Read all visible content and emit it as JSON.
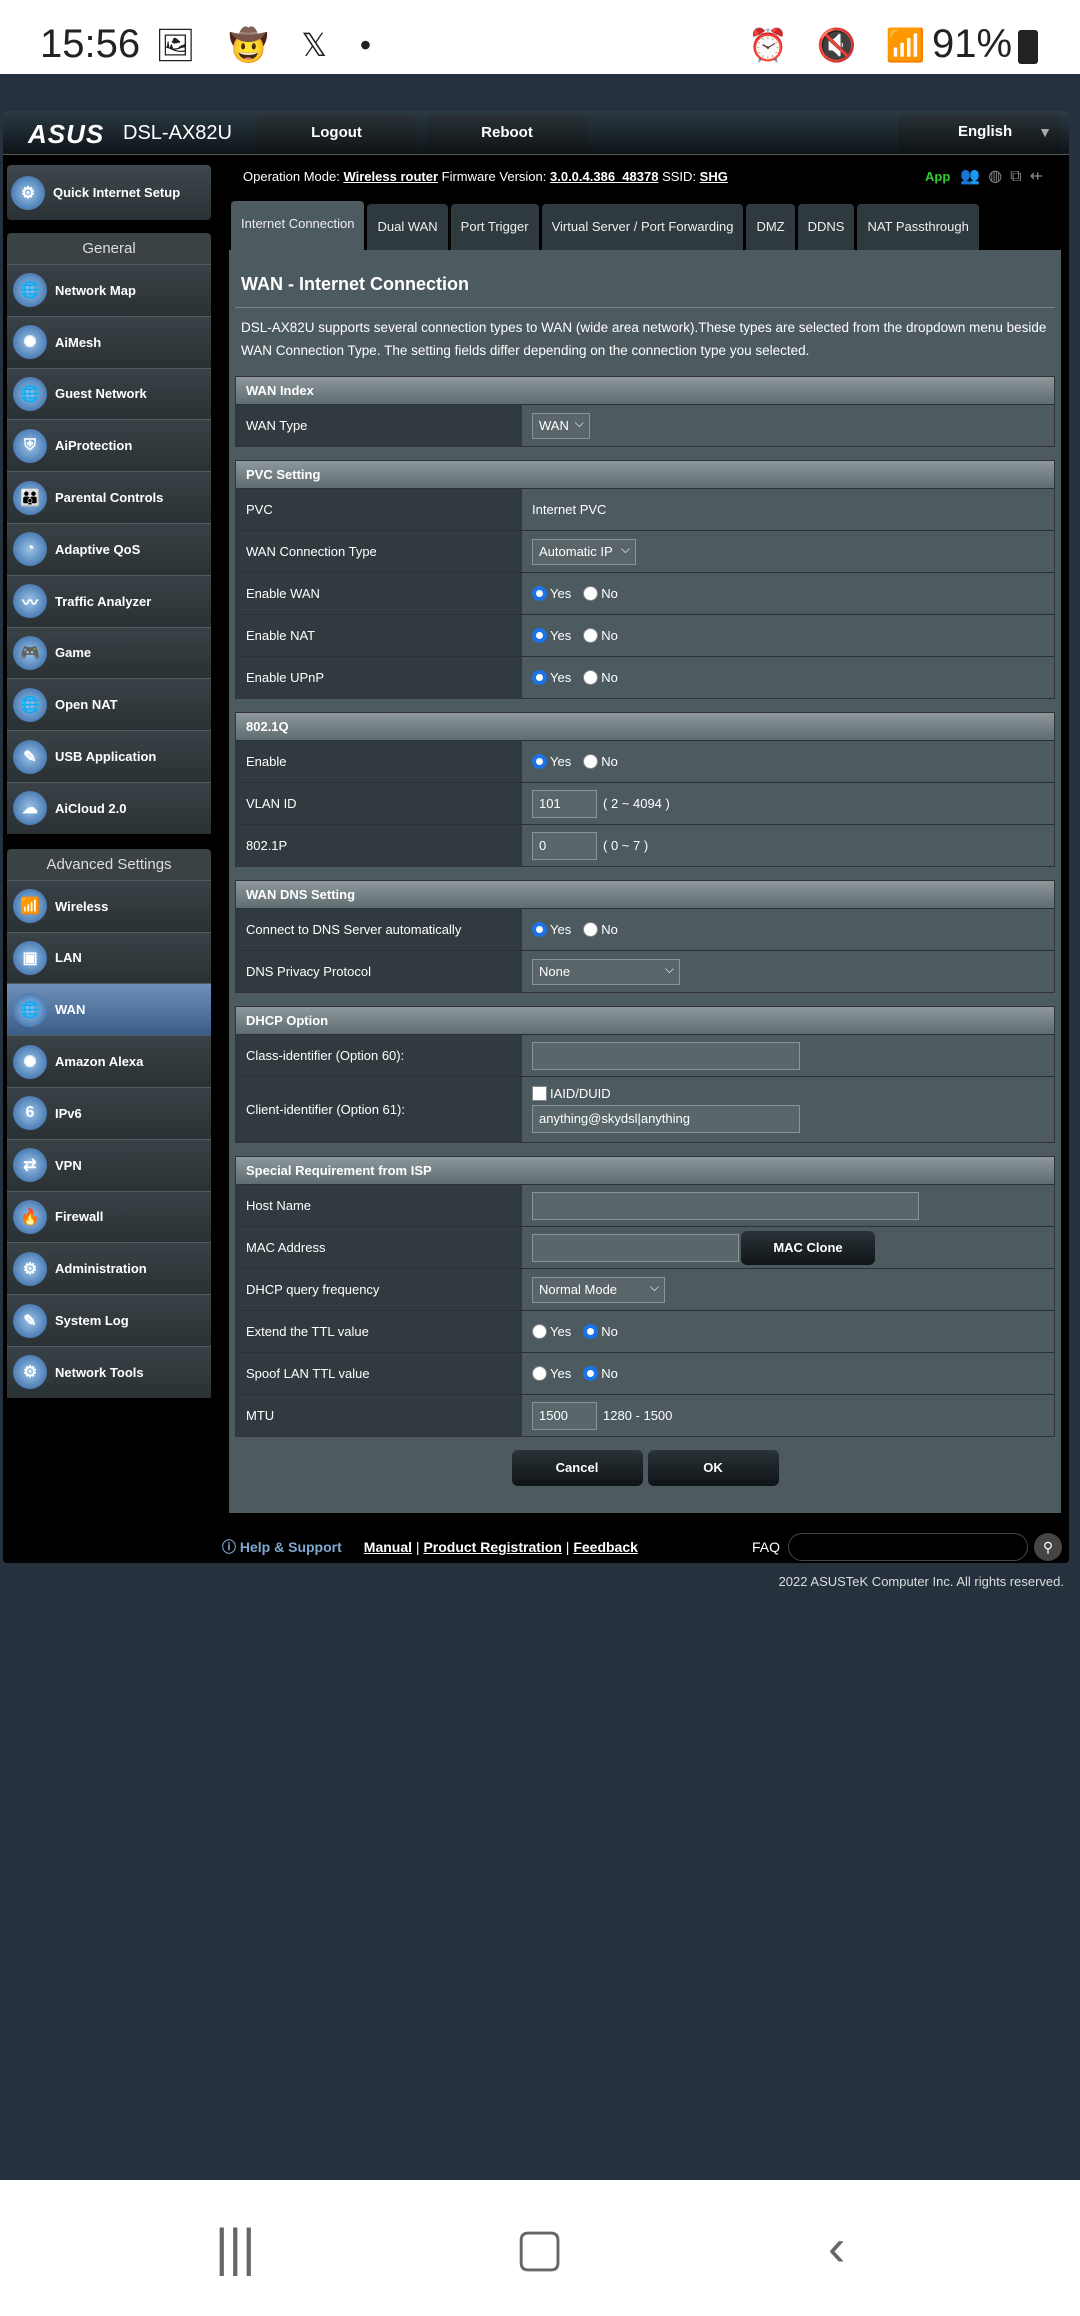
{
  "statusbar": {
    "time": "15:56",
    "battery": "91%"
  },
  "header": {
    "brand": "ASUS",
    "model": "DSL-AX82U",
    "logout": "Logout",
    "reboot": "Reboot",
    "language": "English"
  },
  "info": {
    "op_mode_label": "Operation Mode:",
    "op_mode": "Wireless router",
    "fw_label": "Firmware Version:",
    "fw": "3.0.0.4.386_48378",
    "ssid_label": "SSID:",
    "ssid": "SHG",
    "app": "App"
  },
  "sidebar": {
    "qis": "Quick Internet Setup",
    "general_title": "General",
    "general": [
      {
        "label": "Network Map",
        "icon": "network-map-icon",
        "g": "🌐"
      },
      {
        "label": "AiMesh",
        "icon": "aimesh-icon",
        "g": "✺"
      },
      {
        "label": "Guest Network",
        "icon": "guest-network-icon",
        "g": "🌐"
      },
      {
        "label": "AiProtection",
        "icon": "shield-icon",
        "g": "⛨"
      },
      {
        "label": "Parental Controls",
        "icon": "parental-controls-icon",
        "g": "👪"
      },
      {
        "label": "Adaptive QoS",
        "icon": "gauge-icon",
        "g": "◔"
      },
      {
        "label": "Traffic Analyzer",
        "icon": "traffic-analyzer-icon",
        "g": "〰"
      },
      {
        "label": "Game",
        "icon": "gamepad-icon",
        "g": "🎮"
      },
      {
        "label": "Open NAT",
        "icon": "open-nat-icon",
        "g": "🌐"
      },
      {
        "label": "USB Application",
        "icon": "usb-icon",
        "g": "✎"
      },
      {
        "label": "AiCloud 2.0",
        "icon": "cloud-icon",
        "g": "☁"
      }
    ],
    "advanced_title": "Advanced Settings",
    "advanced": [
      {
        "label": "Wireless",
        "icon": "wireless-icon",
        "g": "📶"
      },
      {
        "label": "LAN",
        "icon": "lan-icon",
        "g": "▣"
      },
      {
        "label": "WAN",
        "icon": "wan-globe-icon",
        "g": "🌐",
        "active": true
      },
      {
        "label": "Amazon Alexa",
        "icon": "alexa-icon",
        "g": "✺"
      },
      {
        "label": "IPv6",
        "icon": "ipv6-icon",
        "g": "6"
      },
      {
        "label": "VPN",
        "icon": "vpn-icon",
        "g": "⇄"
      },
      {
        "label": "Firewall",
        "icon": "firewall-icon",
        "g": "🔥"
      },
      {
        "label": "Administration",
        "icon": "gear-icon",
        "g": "⚙"
      },
      {
        "label": "System Log",
        "icon": "system-log-icon",
        "g": "✎"
      },
      {
        "label": "Network Tools",
        "icon": "network-tools-icon",
        "g": "⚙"
      }
    ]
  },
  "tabs": [
    {
      "label": "Internet Connection",
      "active": true
    },
    {
      "label": "Dual WAN"
    },
    {
      "label": "Port Trigger"
    },
    {
      "label": "Virtual Server / Port Forwarding"
    },
    {
      "label": "DMZ"
    },
    {
      "label": "DDNS"
    },
    {
      "label": "NAT Passthrough"
    }
  ],
  "page": {
    "title": "WAN - Internet Connection",
    "description": "DSL-AX82U supports several connection types to WAN (wide area network).These types are selected from the dropdown menu beside WAN Connection Type. The setting fields differ depending on the connection type you selected."
  },
  "radio": {
    "yes": "Yes",
    "no": "No"
  },
  "sections": [
    {
      "title": "WAN Index",
      "rows": [
        {
          "key": "wan_type",
          "label": "WAN Type",
          "type": "select",
          "value": "WAN"
        }
      ]
    },
    {
      "title": "PVC Setting",
      "rows": [
        {
          "key": "pvc",
          "label": "PVC",
          "type": "text",
          "value": "Internet PVC"
        },
        {
          "key": "conn_type",
          "label": "WAN Connection Type",
          "type": "select",
          "value": "Automatic IP"
        },
        {
          "key": "enable_wan",
          "label": "Enable WAN",
          "type": "radio",
          "value": "yes"
        },
        {
          "key": "enable_nat",
          "label": "Enable NAT",
          "type": "radio",
          "value": "yes"
        },
        {
          "key": "enable_upnp",
          "label": "Enable UPnP",
          "type": "radio",
          "value": "yes"
        }
      ]
    },
    {
      "title": "802.1Q",
      "rows": [
        {
          "key": "vlan_enable",
          "label": "Enable",
          "type": "radio",
          "value": "yes"
        },
        {
          "key": "vlan_id",
          "label": "VLAN ID",
          "type": "input",
          "value": "101",
          "hint": "( 2 ~ 4094 )"
        },
        {
          "key": "p8021p",
          "label": "802.1P",
          "type": "input",
          "value": "0",
          "hint": "( 0 ~ 7 )"
        }
      ]
    },
    {
      "title": "WAN DNS Setting",
      "rows": [
        {
          "key": "dns_auto",
          "label": "Connect to DNS Server automatically",
          "type": "radio",
          "value": "yes"
        },
        {
          "key": "dns_privacy",
          "label": "DNS Privacy Protocol",
          "type": "select",
          "value": "None"
        }
      ]
    },
    {
      "title": "DHCP Option",
      "rows": [
        {
          "key": "opt60",
          "label": "Class-identifier (Option 60):",
          "type": "input",
          "value": ""
        },
        {
          "key": "opt61",
          "label": "Client-identifier (Option 61):",
          "type": "checkinput",
          "checkbox_label": "IAID/DUID",
          "checked": false,
          "value": "anything@skydsl|anything"
        }
      ]
    },
    {
      "title": "Special Requirement from ISP",
      "rows": [
        {
          "key": "hostname",
          "label": "Host Name",
          "type": "input",
          "value": ""
        },
        {
          "key": "mac",
          "label": "MAC Address",
          "type": "inputbutton",
          "value": "",
          "button": "MAC Clone"
        },
        {
          "key": "dhcp_freq",
          "label": "DHCP query frequency",
          "type": "select",
          "value": "Normal Mode"
        },
        {
          "key": "ttl",
          "label": "Extend the TTL value",
          "type": "radio",
          "value": "no"
        },
        {
          "key": "spoof_ttl",
          "label": "Spoof LAN TTL value",
          "type": "radio",
          "value": "no"
        },
        {
          "key": "mtu",
          "label": "MTU",
          "type": "input",
          "value": "1500",
          "hint": "1280 - 1500"
        }
      ]
    }
  ],
  "actions": {
    "cancel": "Cancel",
    "ok": "OK"
  },
  "footer": {
    "help": "Help & Support",
    "manual": "Manual",
    "registration": "Product Registration",
    "feedback": "Feedback",
    "faq": "FAQ",
    "copyright": "2022 ASUSTeK Computer Inc. All rights reserved."
  }
}
